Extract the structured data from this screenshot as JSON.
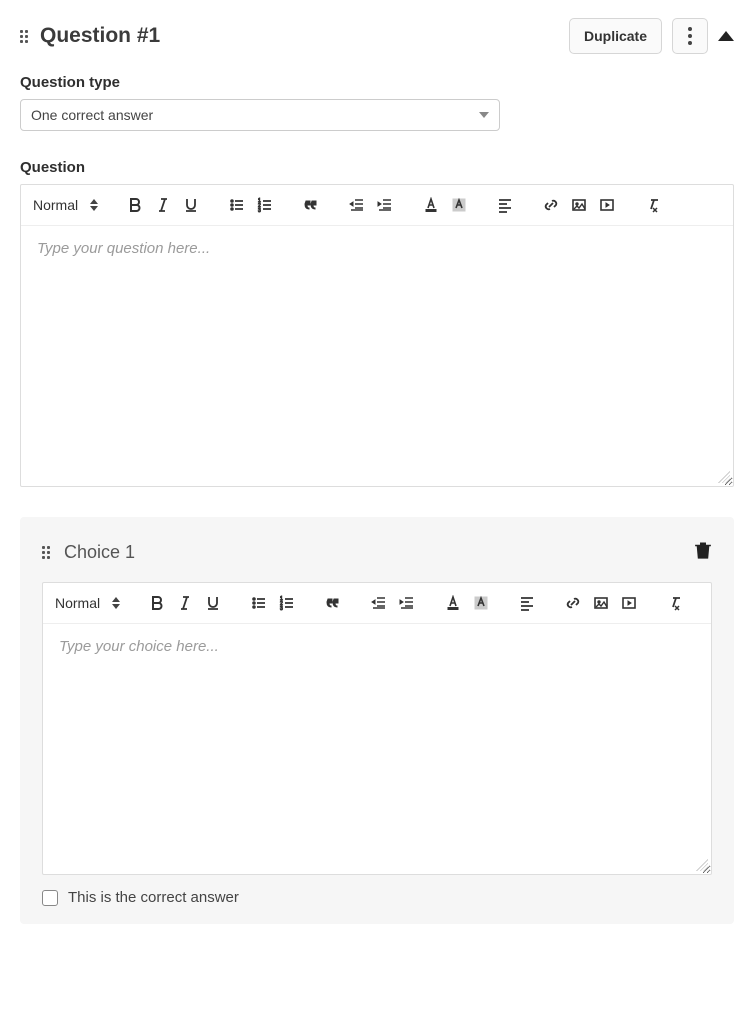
{
  "header": {
    "title": "Question #1",
    "duplicate_label": "Duplicate"
  },
  "question_type": {
    "label": "Question type",
    "selected": "One correct answer"
  },
  "question_editor": {
    "label": "Question",
    "format": "Normal",
    "placeholder": "Type your question here..."
  },
  "choice": {
    "title": "Choice 1",
    "format": "Normal",
    "placeholder": "Type your choice here...",
    "correct_label": "This is the correct answer",
    "is_correct": false
  }
}
